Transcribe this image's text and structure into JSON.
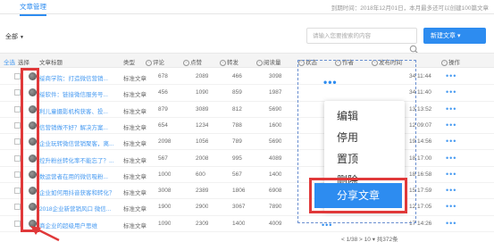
{
  "tabs": {
    "active": "文章管理"
  },
  "expiry_notice": "到期时间：2018年12月01日，本月最多还可以创建100篇文章",
  "toolbar": {
    "filter_label": "全部",
    "search_placeholder": "请输入您要搜索的内容",
    "new_button_label": "新建文章"
  },
  "table": {
    "headers": {
      "select_all": "全选",
      "select": "选择",
      "title": "文章标题",
      "type": "类型",
      "comments": "评论",
      "likes": "点赞",
      "shares": "转发",
      "reads": "阅读量",
      "status": "状态",
      "author": "作者",
      "publish_time": "发布时间",
      "ops": "操作"
    },
    "rows": [
      {
        "title": "绥商学院：打造微信营销...",
        "type": "标准文章",
        "comments": "678",
        "likes": "2089",
        "shares": "466",
        "reads": "3098",
        "time": "34 11:44"
      },
      {
        "title": "绥软件：链接微信服务号...",
        "type": "标准文章",
        "comments": "456",
        "likes": "1090",
        "shares": "859",
        "reads": "1987",
        "time": "34 11:40"
      },
      {
        "title": "利儿童摄影机构获客、投...",
        "type": "标准文章",
        "comments": "879",
        "likes": "3089",
        "shares": "812",
        "reads": "5690",
        "time": "13 13:52"
      },
      {
        "title": "信营销做不好？解决方案...",
        "type": "标准文章",
        "comments": "654",
        "likes": "1234",
        "shares": "788",
        "reads": "1600",
        "time": "12 09:07"
      },
      {
        "title": "企业玩转微信营销聚客，离...",
        "type": "标准文章",
        "comments": "2098",
        "likes": "1056",
        "shares": "789",
        "reads": "5690",
        "time": "19 14:56"
      },
      {
        "title": "控升粉丝转化率不能忘了？...",
        "type": "标准文章",
        "comments": "567",
        "likes": "2008",
        "shares": "995",
        "reads": "4089",
        "time": "18 17:00"
      },
      {
        "title": "数运营者在用的微信吸粉...",
        "type": "标准文章",
        "comments": "1000",
        "likes": "600",
        "shares": "567",
        "reads": "1400",
        "time": "18 16:58"
      },
      {
        "title": "企业如何用抖音获客和转化？",
        "type": "标准文章",
        "comments": "3008",
        "likes": "2389",
        "shares": "1806",
        "reads": "6908",
        "time": "15 17:59"
      },
      {
        "title": "2018企业新营销风口 微信...",
        "type": "标准文章",
        "comments": "1900",
        "likes": "2900",
        "shares": "3067",
        "reads": "7890",
        "time": "12 17:05"
      },
      {
        "title": "商企业的超级用户思维",
        "type": "标准文章",
        "comments": "1090",
        "likes": "2309",
        "shares": "1400",
        "reads": "4009",
        "time": "17 14:26"
      }
    ],
    "ops_glyph": "•••"
  },
  "context_menu": {
    "trigger_glyph": "•••",
    "items": [
      "编辑",
      "停用",
      "置顶",
      "删除"
    ],
    "highlighted_item": "分享文章"
  },
  "pager": {
    "text": "< 1/38 > 10 ▾ 共372条"
  },
  "colors": {
    "accent": "#2d8cf0",
    "highlight_border": "#e0393a"
  }
}
